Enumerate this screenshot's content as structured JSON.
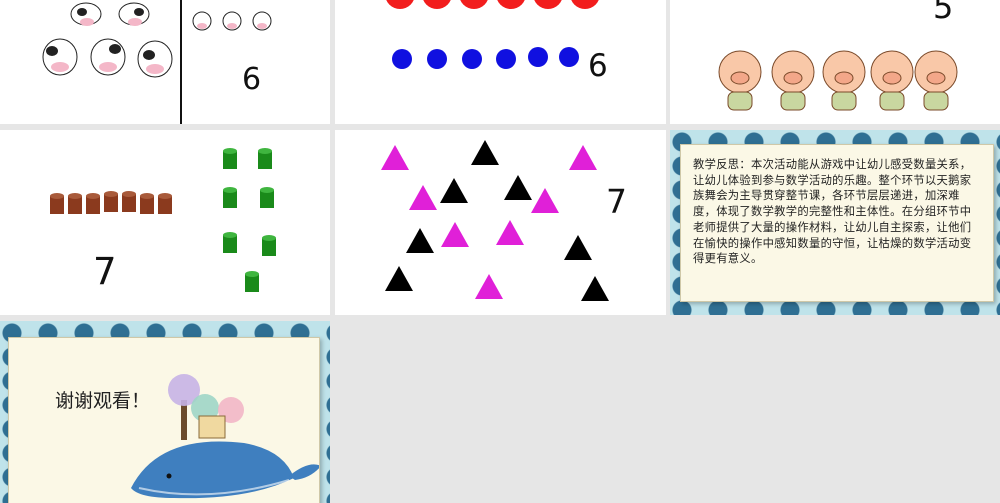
{
  "slides": {
    "cows": {
      "number": "6"
    },
    "dots": {
      "number": "6"
    },
    "pigs": {
      "number": "5"
    },
    "cylinders": {
      "number": "7"
    },
    "triangles": {
      "number": "7"
    },
    "reflection": {
      "text": "教学反思：本次活动能从游戏中让幼儿感受数量关系，让幼儿体验到参与数学活动的乐趣。整个环节以天鹅家族舞会为主导贯穿整节课，各环节层层递进，加深难度，体现了数学教学的完整性和主体性。在分组环节中老师提供了大量的操作材料，让幼儿自主探索，让他们在愉快的操作中感知数量的守恒，让枯燥的数学活动变得更有意义。"
    },
    "thanks": {
      "text": "谢谢观看！"
    }
  },
  "colors": {
    "dot_red": "#f21d1d",
    "dot_blue": "#1010e0",
    "cylinder_brown": "#8b3a1e",
    "cylinder_green": "#1a8a1a",
    "triangle_pink": "#e020d8",
    "triangle_black": "#000000",
    "wave_dark": "#2f6f93",
    "wave_light": "#bfe3ea"
  },
  "icons": [
    "cow-icon",
    "pig-icon",
    "whale-icon",
    "treehouse-icon"
  ]
}
